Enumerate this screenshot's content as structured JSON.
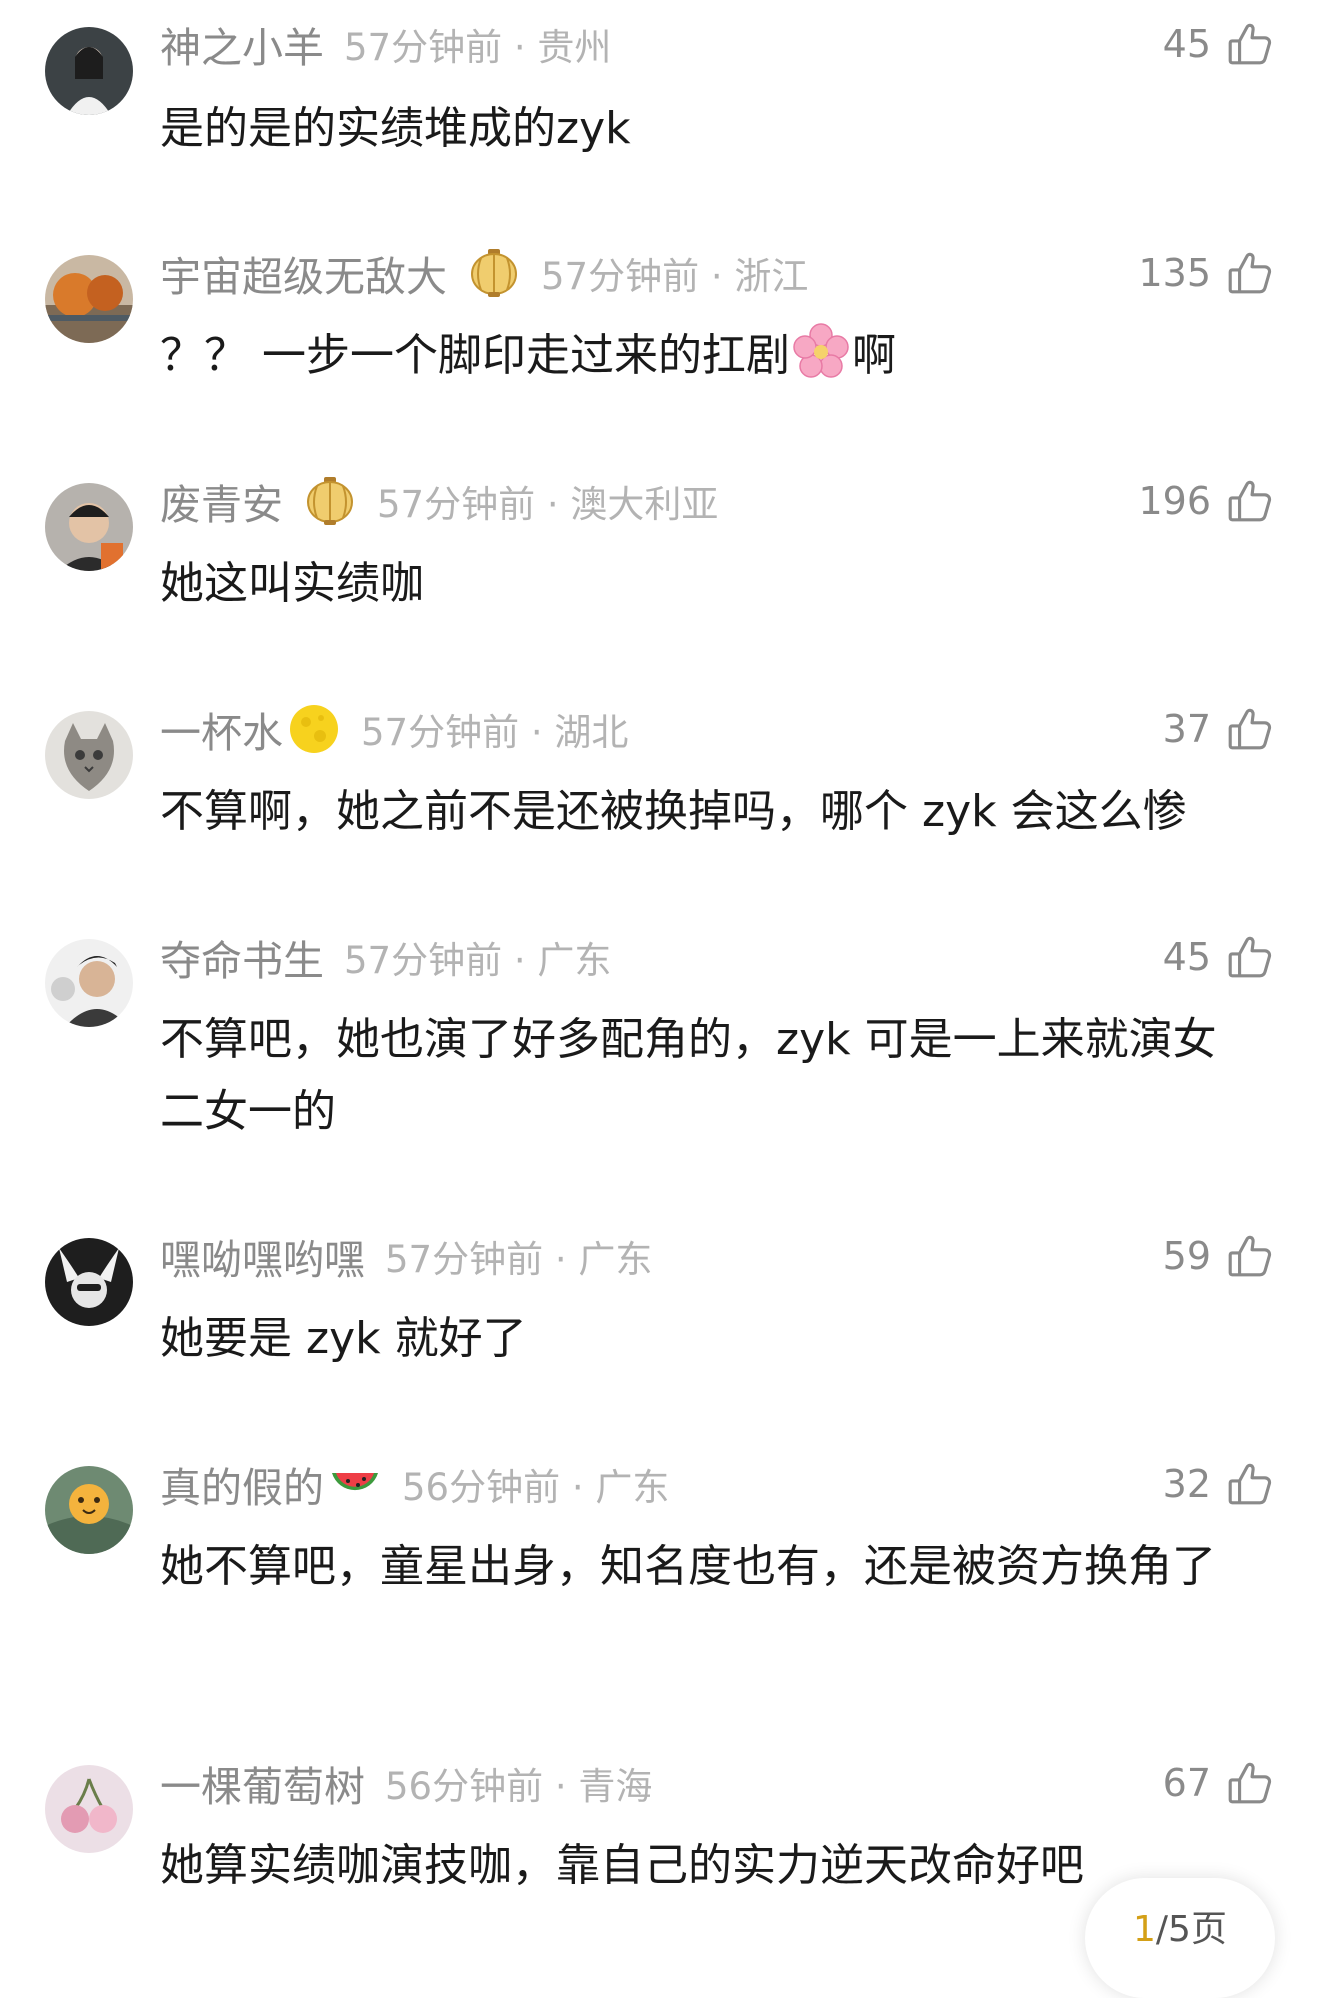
{
  "comments": [
    {
      "username": "神之小羊",
      "time": "57分钟前",
      "location": "贵州",
      "likes": "45",
      "text": "是的是的实绩堆成的zyk"
    },
    {
      "username": "宇宙超级无敌大",
      "time": "57分钟前",
      "location": "浙江",
      "likes": "135",
      "text_before": "？？ 一步一个脚印走过来的扛剧",
      "text_after": "啊",
      "badge": "lantern-badge-icon",
      "emoji": "cherry-blossom-emoji"
    },
    {
      "username": "废青安",
      "time": "57分钟前",
      "location": "澳大利亚",
      "likes": "196",
      "text": "她这叫实绩咖",
      "badge": "lantern-badge-icon"
    },
    {
      "username": "一杯水",
      "time": "57分钟前",
      "location": "湖北",
      "likes": "37",
      "text": "不算啊，她之前不是还被换掉吗，哪个 zyk 会这么惨",
      "badge": "moon-badge-icon"
    },
    {
      "username": "夺命书生",
      "time": "57分钟前",
      "location": "广东",
      "likes": "45",
      "text": "不算吧，她也演了好多配角的，zyk 可是一上来就演女二女一的"
    },
    {
      "username": "嘿呦嘿哟嘿",
      "time": "57分钟前",
      "location": "广东",
      "likes": "59",
      "text": "她要是 zyk 就好了"
    },
    {
      "username": "真的假的",
      "time": "56分钟前",
      "location": "广东",
      "likes": "32",
      "text": "她不算吧，童星出身，知名度也有，还是被资方换角了",
      "badge": "watermelon-badge-icon"
    },
    {
      "username": "一棵葡萄树",
      "time": "56分钟前",
      "location": "青海",
      "likes": "67",
      "text": "她算实绩咖演技咖，靠自己的实力逆天改命好吧"
    }
  ],
  "pager": {
    "current": "1",
    "rest": "/5页"
  },
  "colors": {
    "username": "#8a8a8a",
    "meta": "#b3b3b3",
    "text": "#1a1a1a",
    "pager_current": "#d4a017"
  }
}
